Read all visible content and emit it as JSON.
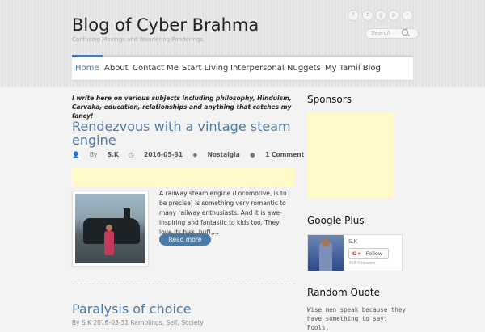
{
  "site": {
    "title": "Blog of Cyber Brahma",
    "tagline": "Confusing Musings and Wandering Ponderings."
  },
  "social": [
    {
      "name": "facebook-icon",
      "glyph": "f"
    },
    {
      "name": "twitter-icon",
      "glyph": "t"
    },
    {
      "name": "google-plus-icon",
      "glyph": "g"
    },
    {
      "name": "pinterest-icon",
      "glyph": "p"
    },
    {
      "name": "rss-icon",
      "glyph": "r"
    }
  ],
  "search": {
    "placeholder": "Search"
  },
  "nav": [
    "Home",
    "About",
    "Contact Me",
    "Start Living",
    "Interpersonal",
    "Nuggets",
    "My Tamil Blog"
  ],
  "intro": "I write here on various subjects including philosophy, Hinduism, Carvaka, education, relationships and anything that catches my fancy!",
  "posts": [
    {
      "title": "Rendezvous with a vintage steam engine",
      "author_prefix": "By",
      "author": "S.K",
      "date": "2016-05-31",
      "category": "Nostalgia",
      "comments": "1 Comment",
      "excerpt": "A railway steam engine (Locomotive, is to be precise) is something very romantic to many railway enthusiasts. And it is awe-inspiring and fantastic to kids too. They love its hiss, huf!,…",
      "read_more": "Read more"
    },
    {
      "title": "Paralysis of choice",
      "meta": "By S.K    2016-03-31    Ramblings, Self, Society"
    }
  ],
  "sidebar": {
    "sponsors": "Sponsors",
    "google_plus": {
      "heading": "Google Plus",
      "name": "S.K",
      "follow": "Follow",
      "followers": "368 followers"
    },
    "random_quote": {
      "heading": "Random Quote",
      "text": "Wise men speak because they have something to say; Fools,"
    }
  }
}
